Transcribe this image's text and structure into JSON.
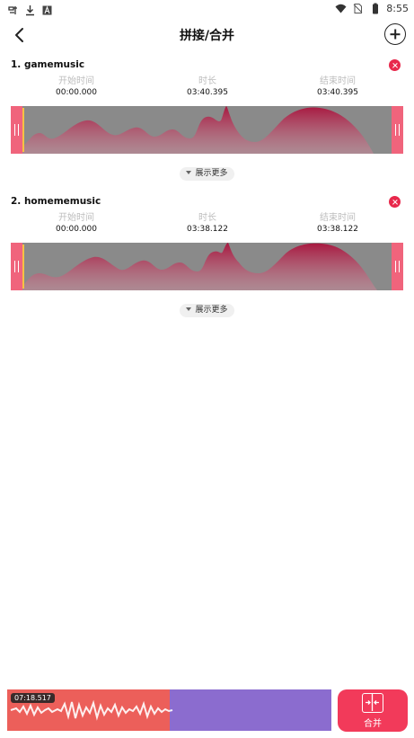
{
  "status_bar": {
    "time": "8:55",
    "left_icons": [
      "notification-icon",
      "download-icon",
      "text-icon"
    ],
    "right_icons": [
      "wifi-icon",
      "no-sim-icon",
      "battery-icon"
    ]
  },
  "header": {
    "title": "拼接/合并",
    "back_icon": "chevron-left-icon",
    "add_icon": "plus-circle-icon"
  },
  "tracks": [
    {
      "name": "1. gamemusic",
      "start_label": "开始时间",
      "start_value": "00:00.000",
      "duration_label": "时长",
      "duration_value": "03:40.395",
      "end_label": "结束时间",
      "end_value": "03:40.395",
      "more_label": "展示更多"
    },
    {
      "name": "2. homememusic",
      "start_label": "开始时间",
      "start_value": "00:00.000",
      "duration_label": "时长",
      "duration_value": "03:38.122",
      "end_label": "结束时间",
      "end_value": "03:38.122",
      "more_label": "展示更多"
    }
  ],
  "player": {
    "current_time": "07:18.517",
    "progress_fraction": 0.5
  },
  "merge_button": {
    "label": "合并",
    "icon": "merge-icon"
  },
  "colors": {
    "accent": "#f23a5a",
    "wave_fill": "#a8173f",
    "handle": "#f0647c",
    "progress_played": "#ec5f5a",
    "progress_remaining": "#8b6ccf"
  }
}
